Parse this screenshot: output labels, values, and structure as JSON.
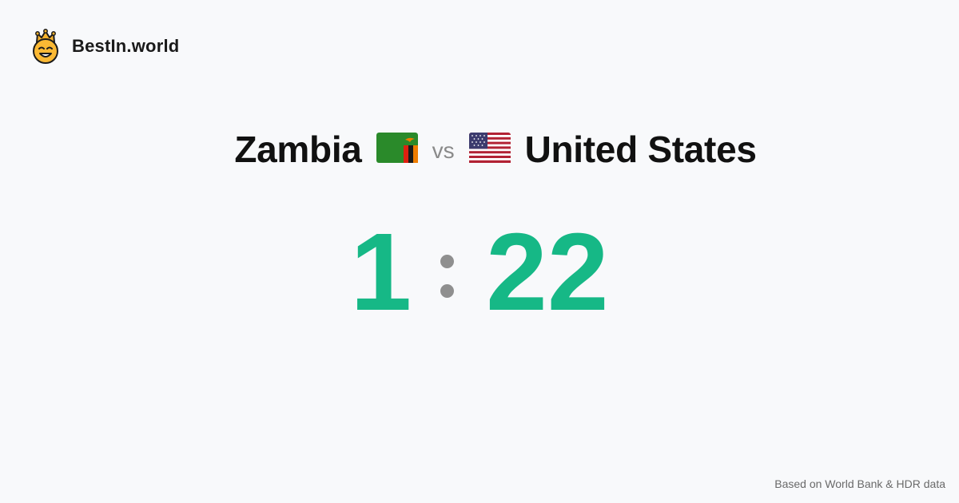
{
  "brand": {
    "name": "BestIn.world",
    "logo_icon": "crowned-smiley-icon"
  },
  "comparison": {
    "left_country": "Zambia",
    "left_flag_icon": "zambia-flag-icon",
    "separator": "vs",
    "right_country": "United States",
    "right_flag_icon": "usa-flag-icon"
  },
  "ratio": {
    "left": "1",
    "right": "22"
  },
  "colors": {
    "accent": "#16b886",
    "muted": "#8f8f8f",
    "background": "#f8f9fb"
  },
  "footer": {
    "source": "Based on World Bank & HDR data"
  }
}
